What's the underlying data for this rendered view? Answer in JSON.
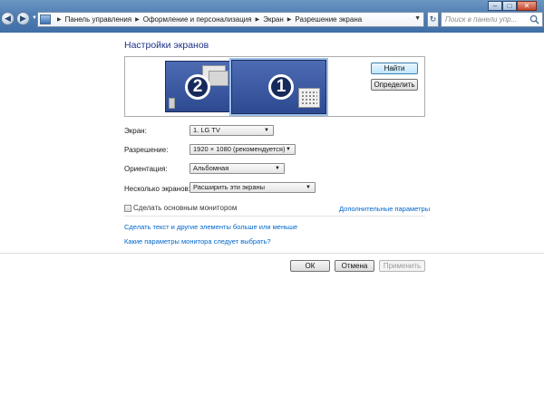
{
  "window": {
    "minimize_glyph": "–",
    "maximize_glyph": "□",
    "close_glyph": "✕"
  },
  "navigation": {
    "back_glyph": "◀",
    "forward_glyph": "▶",
    "refresh_glyph": "↻"
  },
  "breadcrumb": [
    "Панель управления",
    "Оформление и персонализация",
    "Экран",
    "Разрешение экрана"
  ],
  "search": {
    "placeholder": "Поиск в панели упр..."
  },
  "page": {
    "title": "Настройки экранов"
  },
  "monitors": [
    {
      "number": "2"
    },
    {
      "number": "1",
      "selected": true
    }
  ],
  "buttons": {
    "find": "Найти",
    "identify": "Определить",
    "ok": "ОК",
    "cancel": "Отмена",
    "apply": "Применить"
  },
  "fields": {
    "display": {
      "label": "Экран:",
      "value": "1. LG TV"
    },
    "resolution": {
      "label": "Разрешение:",
      "value": "1920 × 1080 (рекомендуется)"
    },
    "orientation": {
      "label": "Ориентация:",
      "value": "Альбомная"
    },
    "multiple": {
      "label": "Несколько экранов:",
      "value": "Расширить эти экраны"
    }
  },
  "checkbox": {
    "label": "Сделать основным монитором",
    "checked": false
  },
  "links": {
    "advanced": "Дополнительные параметры",
    "text_size": "Сделать текст и другие элементы больше или меньше",
    "which_settings": "Какие параметры монитора следует выбрать?"
  },
  "colors": {
    "title": "#1e3287",
    "link": "#0066cc",
    "monitor": "#3a5aa4"
  }
}
